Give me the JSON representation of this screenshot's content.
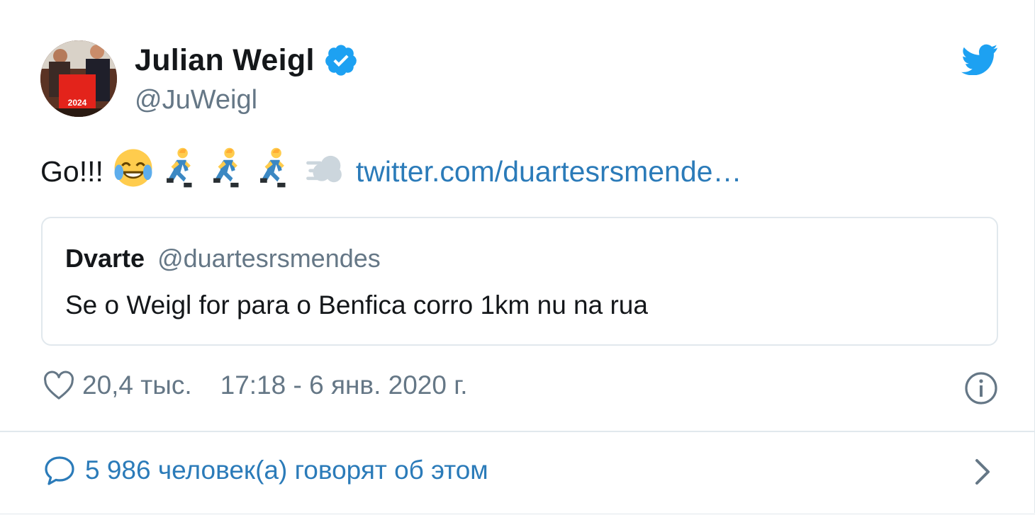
{
  "author": {
    "display_name": "Julian Weigl",
    "handle": "@JuWeigl"
  },
  "avatar": {
    "shirt_text": "2024"
  },
  "tweet": {
    "text": "Go!!!",
    "emojis": [
      "face-with-tears-of-joy",
      "person-running",
      "person-running",
      "person-running",
      "dashing-away"
    ],
    "link": "twitter.com/duartesrsmende…"
  },
  "quoted_tweet": {
    "display_name": "Dvarte",
    "handle": "@duartesrsmendes",
    "text": "Se o Weigl for para o Benfica corro 1km nu na rua"
  },
  "meta": {
    "likes": "20,4 тыс.",
    "timestamp": "17:18 - 6 янв. 2020 г."
  },
  "footer": {
    "conversation": "5 986 человек(а) говорят об этом"
  },
  "colors": {
    "link": "#2b7bb9",
    "twitter_blue": "#1da1f2",
    "secondary_text": "#657786",
    "border": "#e1e8ed"
  }
}
